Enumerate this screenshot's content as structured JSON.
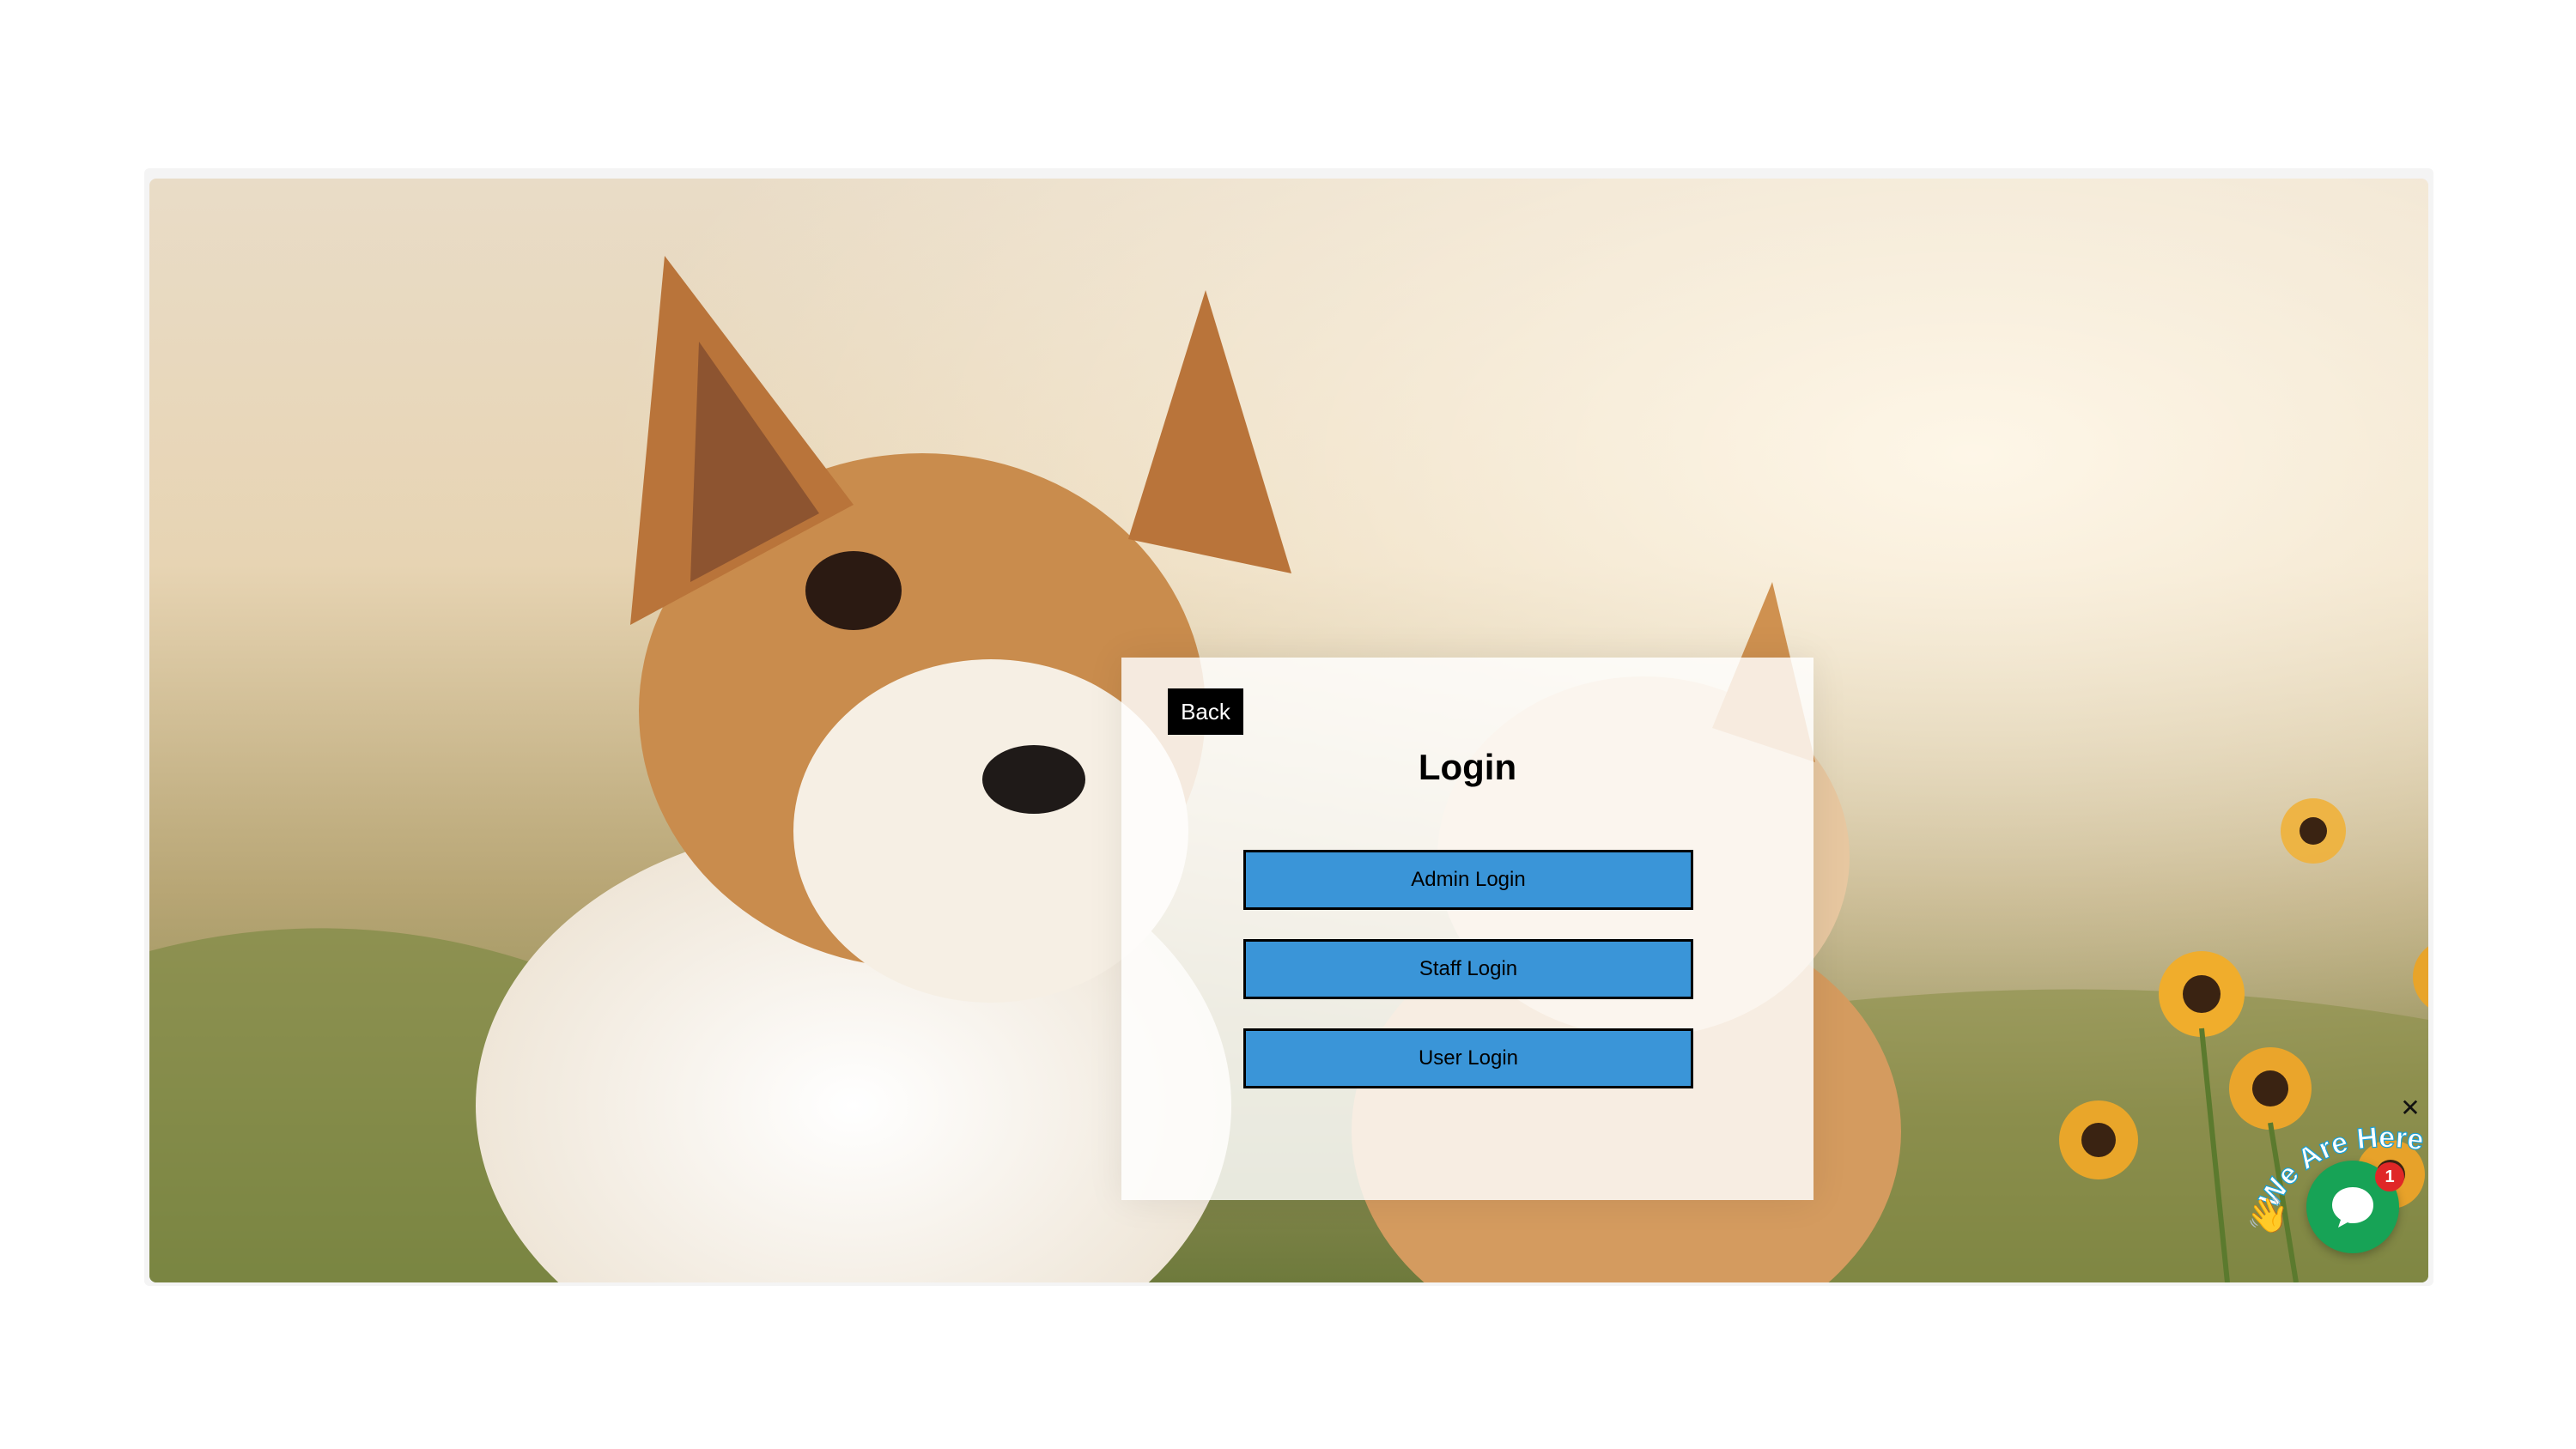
{
  "panel": {
    "back_label": "Back",
    "title": "Login",
    "buttons": [
      "Admin Login",
      "Staff Login",
      "User Login"
    ]
  },
  "chat": {
    "tagline": "We Are Here!",
    "badge_count": "1",
    "close_glyph": "✕",
    "wave_icon": "👋"
  },
  "colors": {
    "button_blue": "#3a95d8",
    "chat_green": "#17a356",
    "badge_red": "#e02727"
  }
}
